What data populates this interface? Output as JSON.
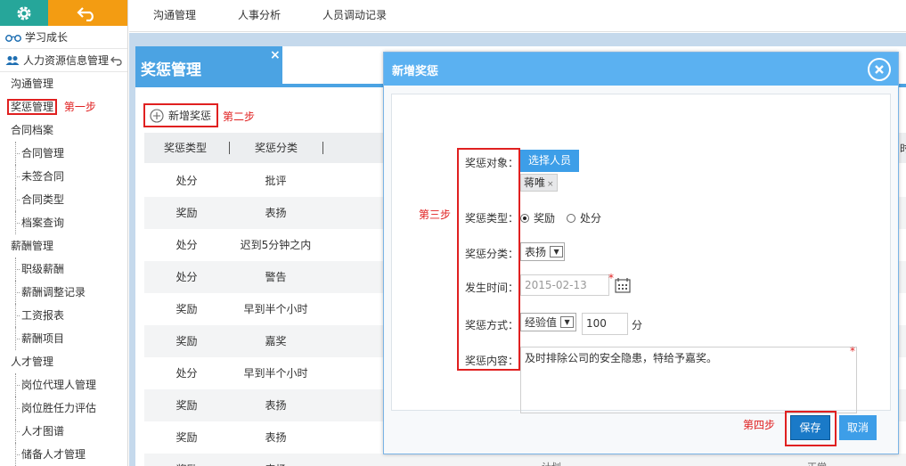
{
  "sidebar": {
    "modules": [
      {
        "label": "学习成长"
      },
      {
        "label": "人力资源信息管理"
      }
    ],
    "items": [
      {
        "label": "沟通管理",
        "level": 1
      },
      {
        "label": "奖惩管理",
        "level": 1
      },
      {
        "label": "合同档案",
        "level": 1
      },
      {
        "label": "合同管理",
        "level": 2
      },
      {
        "label": "未签合同",
        "level": 2
      },
      {
        "label": "合同类型",
        "level": 2
      },
      {
        "label": "档案查询",
        "level": 2
      },
      {
        "label": "薪酬管理",
        "level": 1
      },
      {
        "label": "职级薪酬",
        "level": 2
      },
      {
        "label": "薪酬调整记录",
        "level": 2
      },
      {
        "label": "工资报表",
        "level": 2
      },
      {
        "label": "薪酬项目",
        "level": 2
      },
      {
        "label": "人才管理",
        "level": 1
      },
      {
        "label": "岗位代理人管理",
        "level": 2
      },
      {
        "label": "岗位胜任力评估",
        "level": 2
      },
      {
        "label": "人才图谱",
        "level": 2
      },
      {
        "label": "储备人才管理",
        "level": 2
      }
    ],
    "step1": "第一步"
  },
  "tabs": [
    {
      "label": "沟通管理"
    },
    {
      "label": "人事分析"
    },
    {
      "label": "人员调动记录"
    }
  ],
  "panel": {
    "title": "奖惩管理",
    "close": "×",
    "add_label": "新增奖惩",
    "step2": "第二步",
    "columns": [
      "奖惩类型",
      "奖惩分类"
    ],
    "col_sep": "|",
    "rows": [
      [
        "处分",
        "批评"
      ],
      [
        "奖励",
        "表扬"
      ],
      [
        "处分",
        "迟到5分钟之内"
      ],
      [
        "处分",
        "警告"
      ],
      [
        "奖励",
        "早到半个小时"
      ],
      [
        "奖励",
        "嘉奖"
      ],
      [
        "处分",
        "早到半个小时"
      ],
      [
        "奖励",
        "表扬"
      ],
      [
        "奖励",
        "表扬"
      ],
      [
        "奖励",
        "表扬"
      ]
    ],
    "edge_char": "时",
    "bottom_frag1": "计划",
    "bottom_frag2": "正常"
  },
  "modal": {
    "title": "新增奖惩",
    "step3": "第三步",
    "step4": "第四步",
    "labels": {
      "target": "奖惩对象：",
      "type": "奖惩类型：",
      "category": "奖惩分类：",
      "time": "发生时间：",
      "method": "奖惩方式：",
      "content": "奖惩内容："
    },
    "select_person": "选择人员",
    "person_tag": "蒋唯",
    "tag_close": "×",
    "type_options": [
      {
        "label": "奖励",
        "checked": true
      },
      {
        "label": "处分",
        "checked": false
      }
    ],
    "category_value": "表扬",
    "date_value": "2015-02-13",
    "required_mark": "*",
    "method_value": "经验值",
    "points_value": "100",
    "points_unit": "分",
    "content_value": "及时排除公司的安全隐患，特给予嘉奖。",
    "save_label": "保存",
    "cancel_label": "取消"
  },
  "colors": {
    "accent_blue": "#4ba3e3",
    "modal_header": "#5bb1f1",
    "annotation_red": "#e02020",
    "gear_bg": "#26a69a",
    "back_bg": "#f39c12"
  }
}
